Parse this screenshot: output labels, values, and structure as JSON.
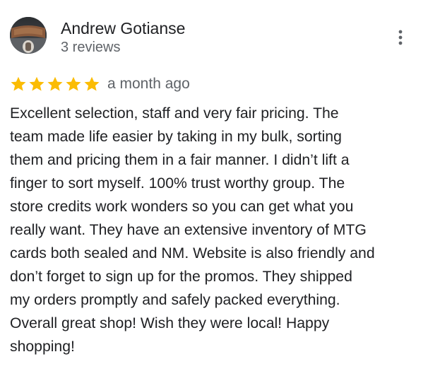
{
  "reviewer": {
    "name": "Andrew Gotianse",
    "review_count": "3 reviews",
    "avatar_icon": "profile-photo"
  },
  "rating": {
    "stars": 5,
    "max": 5,
    "color": "#fbbc04"
  },
  "review": {
    "date": "a month ago",
    "lines": [
      "Excellent selection, staff and very fair pricing. The",
      "team made life easier by taking in my bulk, sorting",
      "them and pricing them in a fair manner. I didn’t lift a",
      "finger to sort myself. 100% trust worthy group. The",
      "store credits work wonders so you can get what you",
      "really want. They have an extensive inventory of MTG",
      "cards both sealed and NM. Website is also friendly and",
      "don’t forget to sign up for the promos. They shipped",
      "my orders promptly and safely packed everything.",
      "Overall great shop! Wish they were local! Happy",
      "shopping!"
    ]
  },
  "menu": {
    "icon": "more-vert-icon"
  }
}
